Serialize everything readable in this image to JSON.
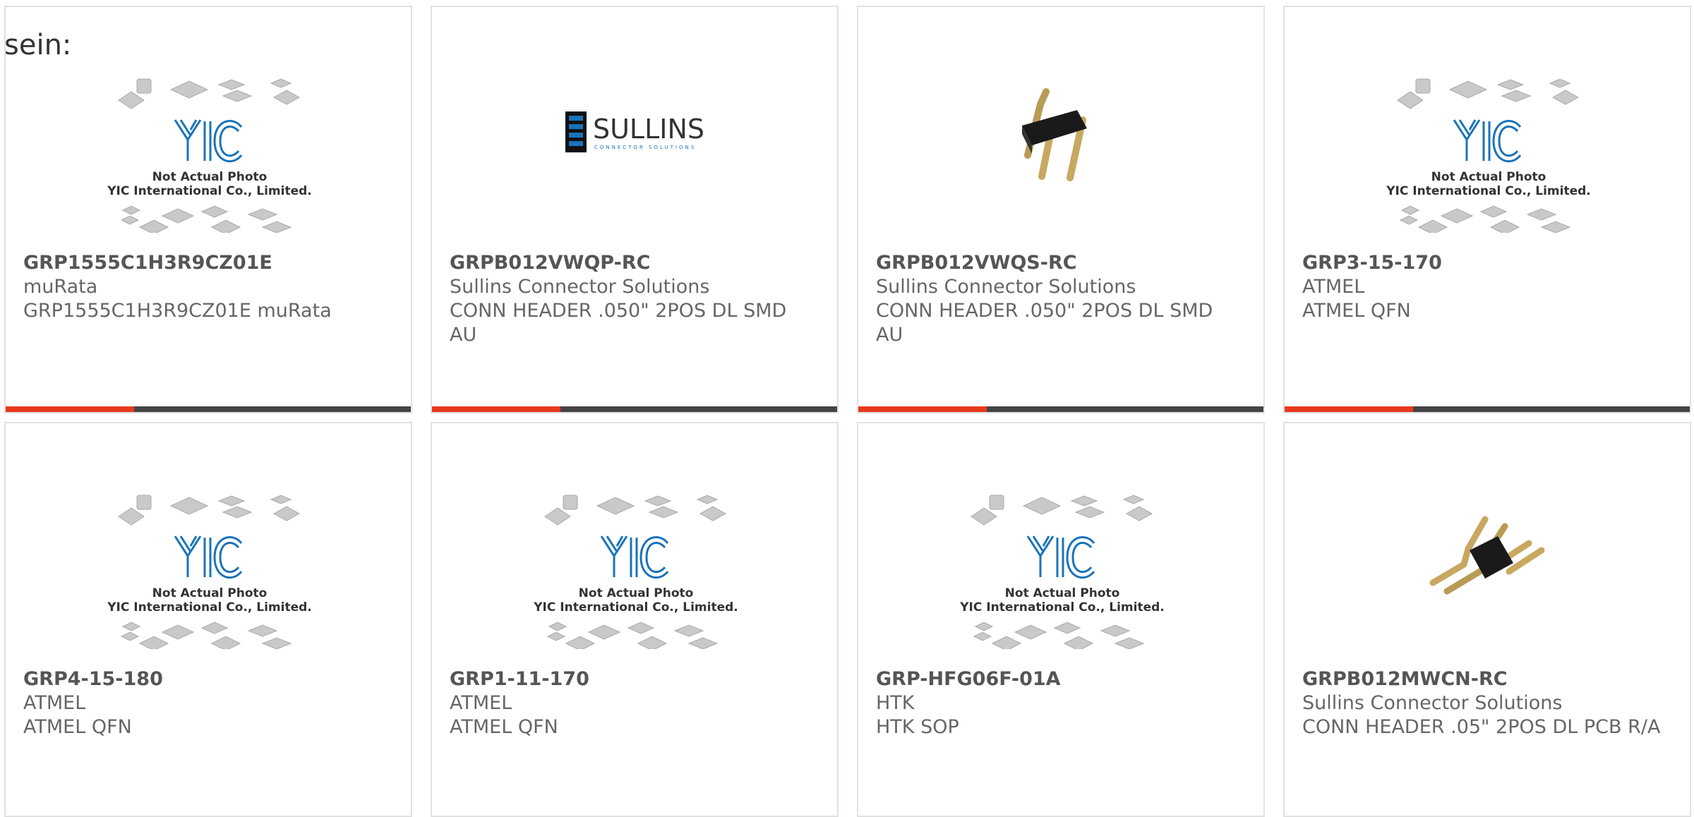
{
  "page": {
    "lead_text": "sein:"
  },
  "placeholder": {
    "logo_text": "YIC",
    "caption_line1": "Not Actual Photo",
    "caption_line2": "YIC International Co., Limited."
  },
  "sullins_logo": {
    "name": "SULLINS",
    "tagline": "CONNECTOR SOLUTIONS"
  },
  "colors": {
    "accent": "#e8391d",
    "bar": "#444444",
    "logo_blue": "#1a73b8",
    "border": "#e1e1e1"
  },
  "products": [
    {
      "part_number": "GRP1555C1H3R9CZ01E",
      "manufacturer": "muRata",
      "description": "GRP1555C1H3R9CZ01E muRata",
      "image": "yic-placeholder"
    },
    {
      "part_number": "GRPB012VWQP-RC",
      "manufacturer": "Sullins Connector Solutions",
      "description": "CONN HEADER .050\" 2POS DL SMD AU",
      "image": "sullins-logo"
    },
    {
      "part_number": "GRPB012VWQS-RC",
      "manufacturer": "Sullins Connector Solutions",
      "description": "CONN HEADER .050\" 2POS DL SMD AU",
      "image": "pin-header-vertical"
    },
    {
      "part_number": "GRP3-15-170",
      "manufacturer": "ATMEL",
      "description": "ATMEL QFN",
      "image": "yic-placeholder"
    },
    {
      "part_number": "GRP4-15-180",
      "manufacturer": "ATMEL",
      "description": "ATMEL QFN",
      "image": "yic-placeholder"
    },
    {
      "part_number": "GRP1-11-170",
      "manufacturer": "ATMEL",
      "description": "ATMEL QFN",
      "image": "yic-placeholder"
    },
    {
      "part_number": "GRP-HFG06F-01A",
      "manufacturer": "HTK",
      "description": "HTK SOP",
      "image": "yic-placeholder"
    },
    {
      "part_number": "GRPB012MWCN-RC",
      "manufacturer": "Sullins Connector Solutions",
      "description": "CONN HEADER .05\" 2POS DL PCB R/A",
      "image": "pin-header-right-angle"
    }
  ]
}
